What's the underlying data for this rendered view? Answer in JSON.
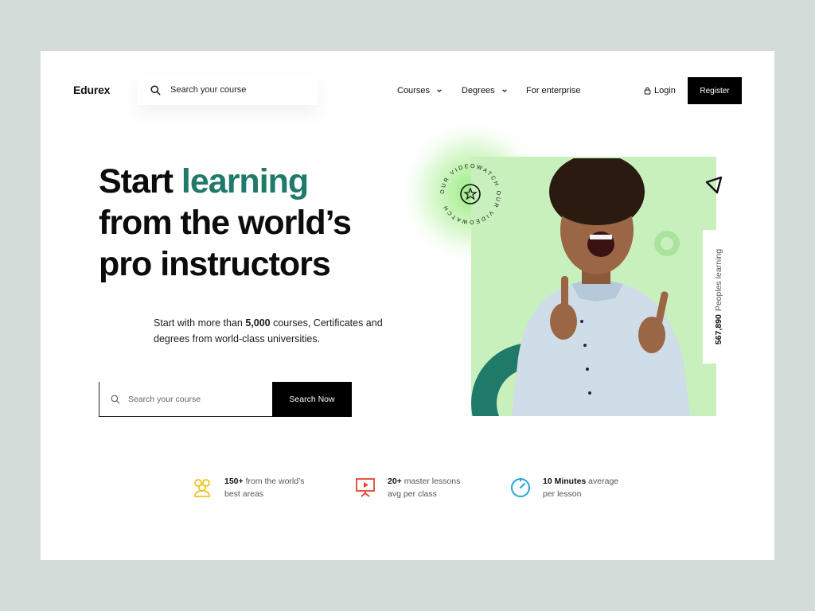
{
  "brand": {
    "name": "Edurex"
  },
  "header": {
    "search_placeholder": "Search your course",
    "nav": [
      {
        "label": "Courses",
        "has_dropdown": true
      },
      {
        "label": "Degrees",
        "has_dropdown": true
      },
      {
        "label": "For enterprise",
        "has_dropdown": false
      }
    ],
    "login_label": "Login",
    "register_label": "Register"
  },
  "hero": {
    "headline_line1_a": "Start ",
    "headline_line1_accent": "learning",
    "headline_line2": "from the world’s",
    "headline_line3": "pro instructors",
    "sub_pre": "Start with more than ",
    "sub_bold": "5,000",
    "sub_post": " courses, Certificates and degrees from world-class universities.",
    "search_placeholder": "Search your course",
    "search_button": "Search Now"
  },
  "visual": {
    "badge_text": "OUR VIDEOWATCH OUR VIDEOWATCH",
    "people_count": "567,890",
    "people_label": "Peoples learning"
  },
  "stats": [
    {
      "bold": "150+",
      "text_a": " from the world’s",
      "text_b": "best areas",
      "icon": "users-icon"
    },
    {
      "bold": "20+",
      "text_a": " master lessons",
      "text_b": "avg per class",
      "icon": "presentation-icon"
    },
    {
      "bold": "10 Minutes",
      "text_a": " average",
      "text_b": "per lesson",
      "icon": "timer-icon"
    }
  ],
  "colors": {
    "accent": "#1f7a6a",
    "green": "#c8f0bd",
    "teal": "#1f7a6a",
    "stat1": "#f2c21a",
    "stat2": "#e5432f",
    "stat3": "#1fa6d9"
  }
}
